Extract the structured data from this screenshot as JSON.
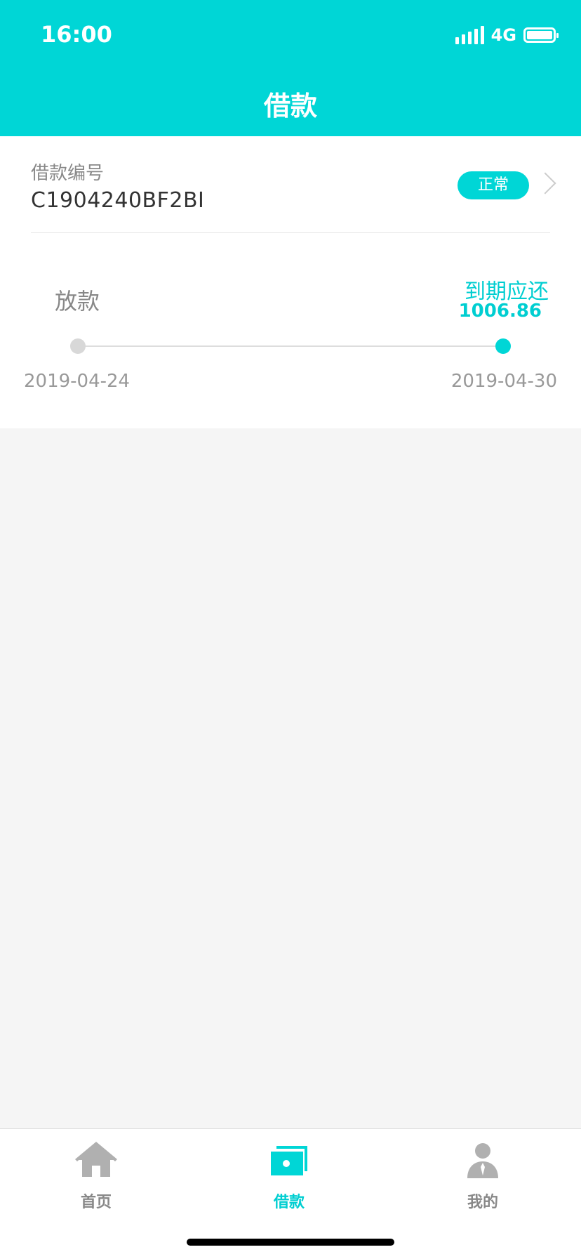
{
  "status_bar": {
    "time": "16:00",
    "network": "4G",
    "icons": [
      "signal-icon",
      "battery-icon"
    ]
  },
  "header": {
    "title": "借款"
  },
  "loan": {
    "number_label": "借款编号",
    "number": "C1904240BF2BI",
    "status": "正常",
    "timeline": {
      "start_label": "放款",
      "start_date": "2019-04-24",
      "end_label": "到期应还",
      "end_amount": "1006.86",
      "end_date": "2019-04-30"
    }
  },
  "tabbar": {
    "items": [
      {
        "label": "首页",
        "icon": "home-icon",
        "active": false
      },
      {
        "label": "借款",
        "icon": "loan-icon",
        "active": true
      },
      {
        "label": "我的",
        "icon": "profile-icon",
        "active": false
      }
    ]
  },
  "colors": {
    "accent": "#00d6d6",
    "inactive": "#b0b0b0",
    "background": "#f5f5f5"
  }
}
